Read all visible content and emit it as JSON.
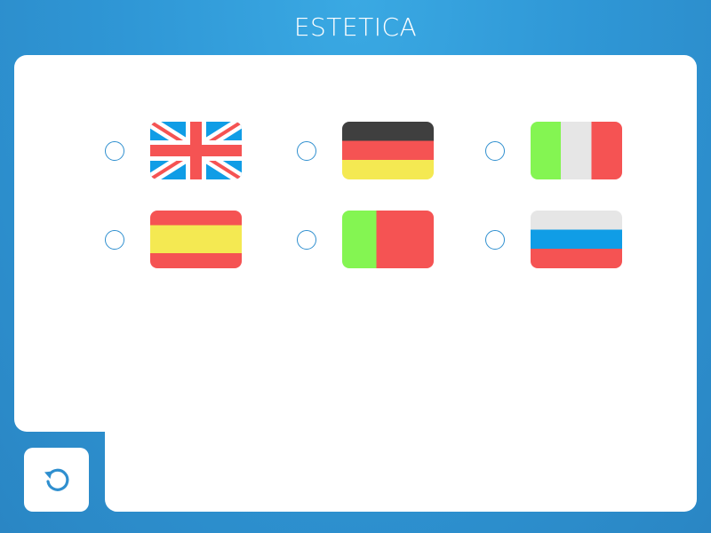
{
  "header": {
    "title": "ESTETICA"
  },
  "languages": [
    {
      "id": "english",
      "flag": "uk-flag-icon",
      "selected": false
    },
    {
      "id": "german",
      "flag": "germany-flag-icon",
      "selected": false
    },
    {
      "id": "italian",
      "flag": "italy-flag-icon",
      "selected": false
    },
    {
      "id": "spanish",
      "flag": "spain-flag-icon",
      "selected": false
    },
    {
      "id": "portuguese",
      "flag": "portugal-flag-icon",
      "selected": false
    },
    {
      "id": "russian",
      "flag": "russia-flag-icon",
      "selected": false
    }
  ],
  "controls": {
    "reset_icon": "refresh-icon"
  },
  "colors": {
    "background": "#2f97d6",
    "panel": "#ffffff",
    "radio_border": "#2f8fcf",
    "flag_red": "#f55353",
    "flag_blue": "#109de6",
    "flag_yellow": "#f4e952",
    "flag_green": "#84f552",
    "flag_dark": "#3f3f3f",
    "flag_light": "#e6e6e6"
  }
}
